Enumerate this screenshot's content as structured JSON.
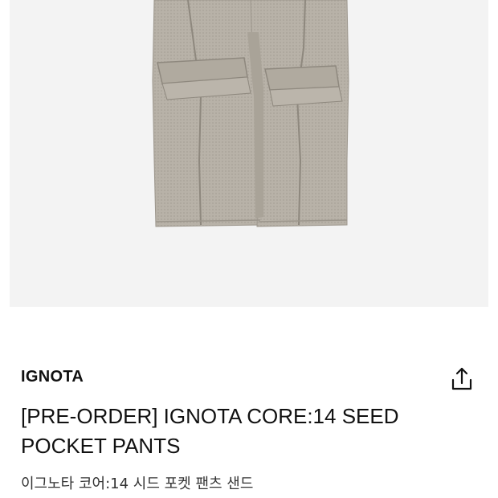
{
  "product": {
    "image_alt": "IGNOTA CORE:14 SEED POCKET PANTS",
    "brand": "IGNOTA",
    "title_line1": "[PRE-ORDER] IGNOTA CORE:14 SEED",
    "title_line2": "POCKET PANTS",
    "subtitle_ko": "이그노타 코어:14 시드 포켓 팬츠 샌드",
    "share_icon": "share-icon"
  },
  "colors": {
    "image_bg": "#f3f3f3",
    "pants": "#b6b0a6",
    "text": "#111111"
  }
}
